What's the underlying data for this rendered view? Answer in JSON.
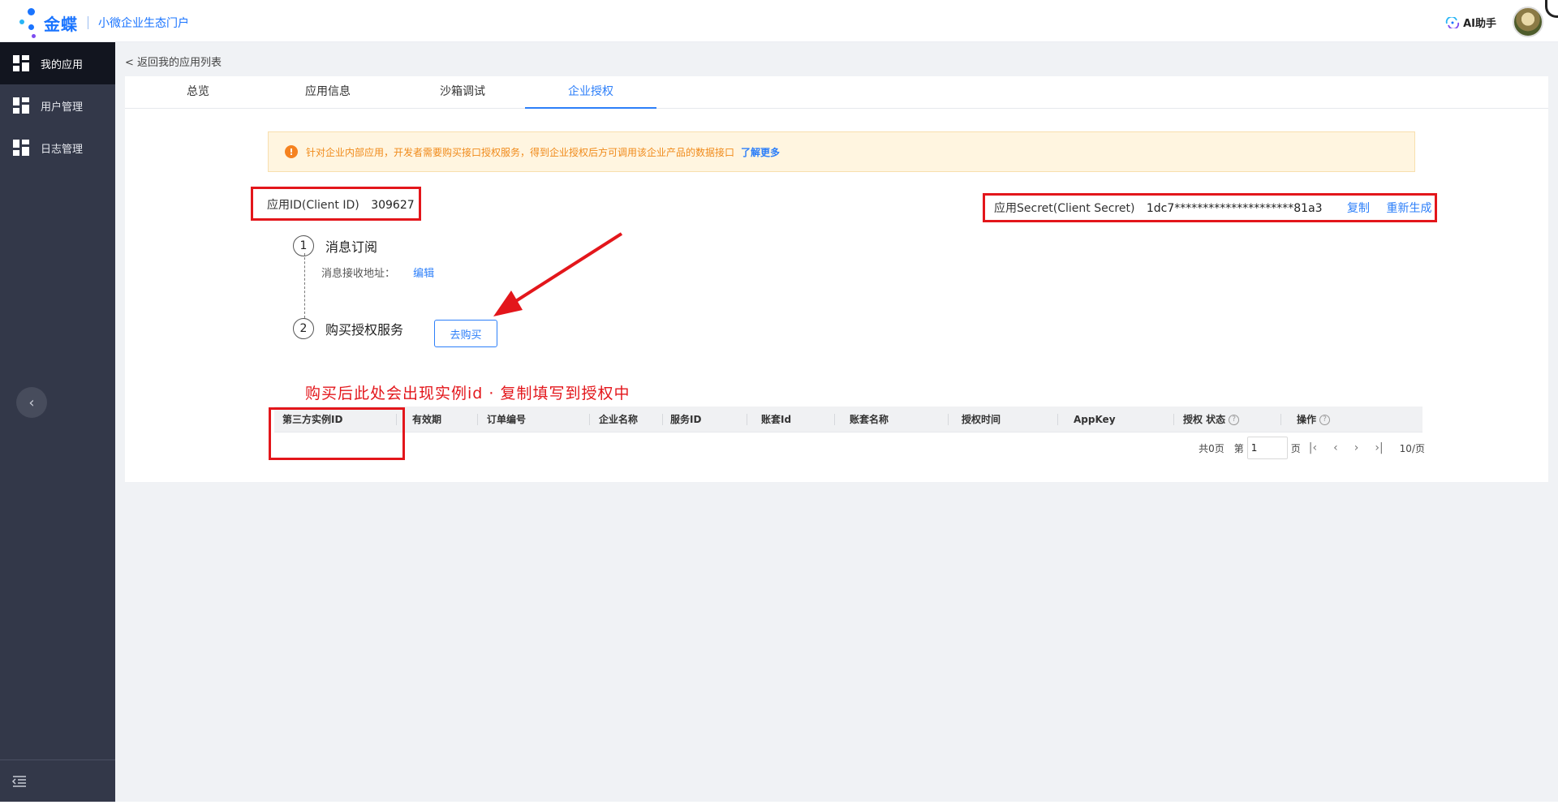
{
  "header": {
    "brand_name": "金蝶",
    "portal_name": "小微企业生态门户",
    "ai_label": "AI助手"
  },
  "sidebar": {
    "items": [
      {
        "label": "我的应用",
        "active": true
      },
      {
        "label": "用户管理",
        "active": false
      },
      {
        "label": "日志管理",
        "active": false
      }
    ],
    "collapse_icon": "chevron-left-icon",
    "bottom_icon": "menu-collapse-icon"
  },
  "main": {
    "back_label": "< 返回我的应用列表",
    "tabs": [
      {
        "label": "总览",
        "active": false
      },
      {
        "label": "应用信息",
        "active": false
      },
      {
        "label": "沙箱调试",
        "active": false
      },
      {
        "label": "企业授权",
        "active": true
      }
    ],
    "notice": {
      "text": "针对企业内部应用，开发者需要购买接口授权服务，得到企业授权后方可调用该企业产品的数据接口",
      "link": "了解更多"
    },
    "client_id": {
      "label": "应用ID(Client ID)",
      "value": "309627"
    },
    "client_secret": {
      "label": "应用Secret(Client Secret)",
      "value": "1dc7*********************81a3",
      "copy_label": "复制",
      "regenerate_label": "重新生成"
    },
    "steps": [
      {
        "num": "1",
        "title": "消息订阅"
      },
      {
        "num": "2",
        "title": "购买授权服务"
      }
    ],
    "subscribe_address_label": "消息接收地址：",
    "subscribe_edit_label": "编辑",
    "buy_button_label": "去购买",
    "annotation_text": "购买后此处会出现实例id · 复制填写到授权中",
    "table": {
      "columns": [
        "第三方实例ID",
        "有效期",
        "订单编号",
        "企业名称",
        "服务ID",
        "账套Id",
        "账套名称",
        "授权时间",
        "AppKey",
        "授权 状态",
        "操作"
      ],
      "rows": []
    },
    "pager": {
      "total": "共0页",
      "page_prefix": "第",
      "page_value": "1",
      "page_suffix": "页",
      "page_size": "10/页"
    }
  },
  "colors": {
    "accent": "#2d7ff9",
    "sidebar_bg": "#333849",
    "annotation_red": "#e3161b",
    "notice_bg": "#fff5e0"
  }
}
